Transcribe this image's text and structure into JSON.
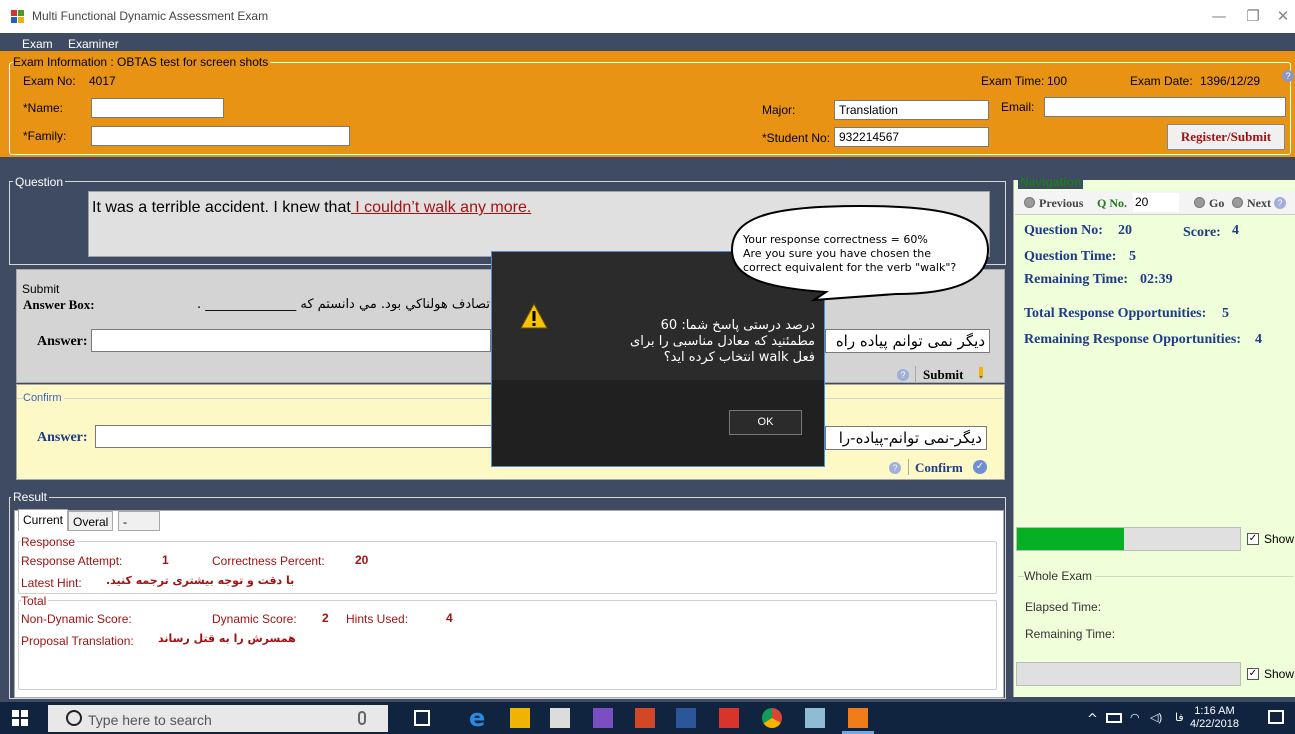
{
  "window": {
    "title": "Multi Functional Dynamic Assessment Exam",
    "minimize": "—",
    "restore": "❐",
    "close": "✕"
  },
  "menu": {
    "items": [
      "Exam",
      "Examiner"
    ]
  },
  "exam_info": {
    "group_title": "Exam Information : OBTAS test for screen shots",
    "exam_no_label": "Exam No:",
    "exam_no": "4017",
    "exam_time_label": "Exam Time:",
    "exam_time": "100",
    "exam_date_label": "Exam Date:",
    "exam_date": "1396/12/29",
    "name_label": "*Name:",
    "name_value": "",
    "family_label": "*Family:",
    "family_value": "",
    "major_label": "Major:",
    "major_value": "Translation",
    "student_no_label": "*Student No:",
    "student_no_value": "932214567",
    "email_label": "Email:",
    "email_value": "",
    "register_label": "Register/Submit"
  },
  "question": {
    "group_title": "Question",
    "text_plain": "It was a terrible accident. I knew that",
    "text_underlined": " I couldn’t walk any more."
  },
  "submit": {
    "group_title": "Submit",
    "answer_box_label": "Answer Box:",
    "answer_box_text": "تصادف هولناكي بود. مي دانستم كه ______________ .",
    "answer_label": "Answer:",
    "answer_value": "",
    "answer_rtl": "دیگر نمی توانم پیاده راه",
    "submit_label": "Submit"
  },
  "confirm": {
    "group_title": "Confirm",
    "answer_label": "Answer:",
    "answer_value": "",
    "answer_rtl": "دیگر-نمی توانم-پیاده-را",
    "confirm_label": "Confirm"
  },
  "result": {
    "group_title": "Result",
    "tabs": [
      "Current",
      "Overal",
      "-"
    ],
    "response_title": "Response",
    "response_attempt_label": "Response Attempt:",
    "response_attempt": "1",
    "correctness_label": "Correctness Percent:",
    "correctness": "20",
    "latest_hint_label": "Latest Hint:",
    "latest_hint": "با دقت و توجه بیشتری ترجمه کنید.",
    "total_title": "Total",
    "non_dynamic_label": "Non-Dynamic Score:",
    "non_dynamic": "",
    "dynamic_label": "Dynamic Score:",
    "dynamic": "2",
    "hints_used_label": "Hints Used:",
    "hints_used": "4",
    "proposal_label": "Proposal Translation:",
    "proposal": "همسرش را به قتل رساند"
  },
  "navigation": {
    "group_title": "Navigation",
    "previous_label": "Previous",
    "qno_label": "Q No.",
    "qno_value": "20",
    "go_label": "Go",
    "next_label": "Next",
    "question_no_label": "Question No:",
    "question_no": "20",
    "score_label": "Score:",
    "score": "4",
    "question_time_label": "Question Time:",
    "question_time": "5",
    "remaining_time_label": "Remaining Time:",
    "remaining_time": "02:39",
    "total_ops_label": "Total Response Opportunities:",
    "total_ops": "5",
    "remaining_ops_label": "Remaining Response Opportunities:",
    "remaining_ops": "4",
    "progress_fraction": 0.48,
    "show_label": "Show",
    "whole_exam_title": "Whole Exam",
    "elapsed_label": "Elapsed Time:",
    "whole_remaining_label": "Remaining Time:",
    "show2_label": "Show"
  },
  "dialog": {
    "line1": "درصد درستی پاسخ شما: 60",
    "line2": "مطمئنید که معادل مناسبی را برای",
    "line3": "فعل walk  انتخاب کرده اید؟",
    "ok_label": "OK"
  },
  "bubble": {
    "line1": "Your response correctness = 60%",
    "line2": "Are you sure you have chosen the",
    "line3": "correct equivalent for the verb \"walk\"?"
  },
  "taskbar": {
    "search_placeholder": "Type here to search",
    "time": "1:16 AM",
    "date": "4/22/2018",
    "lang": "فا"
  },
  "colors": {
    "orange": "#e99314",
    "navy": "#3e4b62",
    "dark_red": "#a31212",
    "nav_green_bg": "#efffd9",
    "progress_green": "#06b025",
    "taskbar": "#10233f"
  }
}
